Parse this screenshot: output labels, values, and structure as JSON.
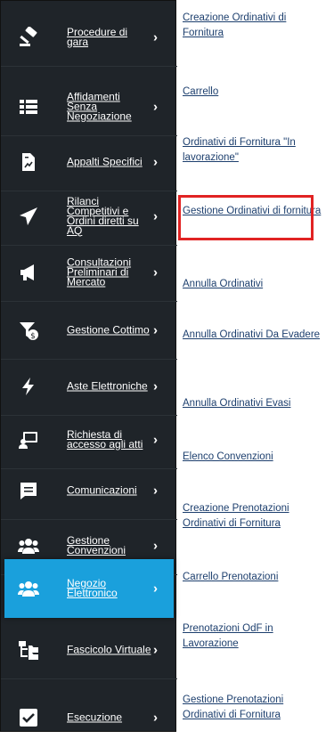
{
  "sidebar": {
    "chevron": "›",
    "items": [
      {
        "label": "Procedure di gara",
        "icon": "gavel-icon"
      },
      {
        "label": "Affidamenti Senza Negoziazione",
        "icon": "list-icon"
      },
      {
        "label": "Appalti Specifici",
        "icon": "document-chart-icon"
      },
      {
        "label": "Rilanci Competitivi e Ordini diretti su AQ",
        "icon": "paper-plane-icon"
      },
      {
        "label": "Consultazioni Preliminari di Mercato",
        "icon": "megaphone-icon"
      },
      {
        "label": "Gestione Cottimo",
        "icon": "funnel-dollar-icon"
      },
      {
        "label": "Aste Elettroniche",
        "icon": "bolt-icon"
      },
      {
        "label": "Richiesta di accesso agli atti",
        "icon": "chalkboard-user-icon"
      },
      {
        "label": "Comunicazioni",
        "icon": "message-icon"
      },
      {
        "label": "Gestione Convenzioni",
        "icon": "users-icon"
      },
      {
        "label": "Negozio Elettronico",
        "icon": "users-icon",
        "active": true
      },
      {
        "label": "Fascicolo Virtuale",
        "icon": "folder-tree-icon"
      },
      {
        "label": "Esecuzione",
        "icon": "check-square-icon"
      }
    ]
  },
  "submenu": {
    "links": [
      "Creazione Ordinativi di Fornitura",
      "Carrello",
      "Ordinativi di Fornitura \"In lavorazione\"",
      "Gestione Ordinativi di fornitura",
      "Annulla Ordinativi",
      "Annulla Ordinativi Da Evadere",
      "Annulla Ordinativi Evasi",
      "Elenco Convenzioni",
      "Creazione Prenotazioni Ordinativi di Fornitura",
      "Carrello Prenotazioni",
      "Prenotazioni OdF in Lavorazione",
      "Gestione Prenotazioni Ordinativi di Fornitura"
    ],
    "highlighted_index": 3
  },
  "colors": {
    "sidebar_bg": "#1f2429",
    "active_bg": "#1aa0dc",
    "link": "#1d3f6e",
    "highlight_border": "#e12323"
  }
}
